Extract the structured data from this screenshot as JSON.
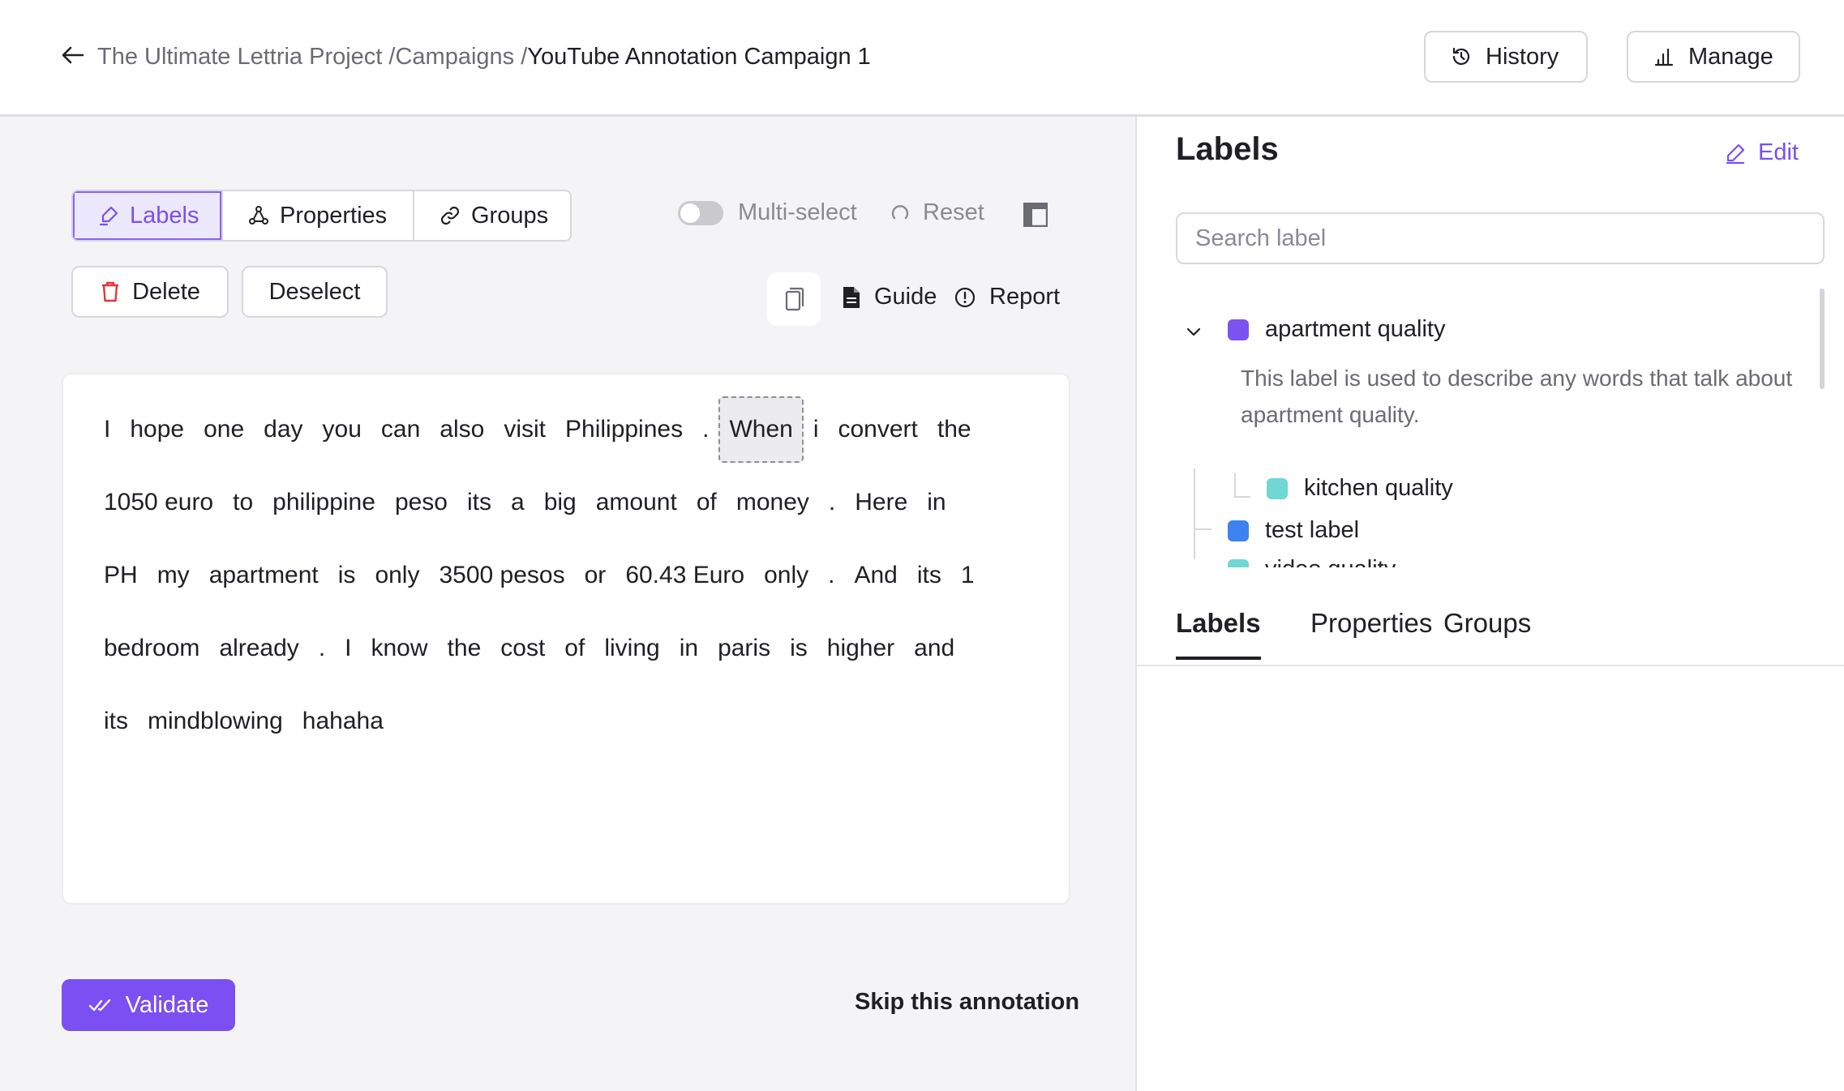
{
  "header": {
    "breadcrumb": [
      "The Ultimate Lettria Project /",
      "Campaigns /"
    ],
    "current": "YouTube Annotation Campaign 1",
    "history_label": "History",
    "manage_label": "Manage"
  },
  "toolbar": {
    "tabs": [
      {
        "label": "Labels",
        "icon": "highlighter-icon",
        "active": true
      },
      {
        "label": "Properties",
        "icon": "nodes-icon",
        "active": false
      },
      {
        "label": "Groups",
        "icon": "link-icon",
        "active": false
      }
    ],
    "multiselect_label": "Multi-select",
    "reset_label": "Reset",
    "delete_label": "Delete",
    "deselect_label": "Deselect",
    "guide_label": "Guide",
    "report_label": "Report"
  },
  "text": {
    "lines": [
      [
        "I",
        "hope",
        "one",
        "day",
        "you",
        "can",
        "also",
        "visit",
        "Philippines",
        ".",
        "When",
        "i",
        "convert",
        "the"
      ],
      [
        "1050 euro",
        "to",
        "philippine",
        "peso",
        "its",
        "a",
        "big",
        "amount",
        "of",
        "money",
        ".",
        "Here",
        "in"
      ],
      [
        "PH",
        "my",
        "apartment",
        "is",
        "only",
        "3500 pesos",
        "or",
        "60.43 Euro",
        "only",
        ".",
        "And",
        "its",
        "1"
      ],
      [
        "bedroom",
        "already",
        ".",
        "I",
        "know",
        "the",
        "cost",
        "of",
        "living",
        "in",
        "paris",
        "is",
        "higher",
        "and"
      ],
      [
        "its",
        "mindblowing",
        "hahaha"
      ]
    ],
    "selected_token": "When"
  },
  "footer": {
    "validate_label": "Validate",
    "skip_label": "Skip this annotation"
  },
  "labels_panel": {
    "title": "Labels",
    "edit_label": "Edit",
    "search_placeholder": "Search label",
    "items": [
      {
        "name": "apartment quality",
        "color": "#7c52f0",
        "description": "This label is used to describe any words that talk about apartment quality."
      },
      {
        "name": "kitchen quality",
        "color": "#6fd7d4"
      },
      {
        "name": "test label",
        "color": "#3c82f0"
      },
      {
        "name": "video quality",
        "color": "#6fd7d4"
      }
    ],
    "bottom_tabs": [
      "Labels",
      "Properties",
      "Groups"
    ],
    "active_bottom_tab": "Labels"
  }
}
